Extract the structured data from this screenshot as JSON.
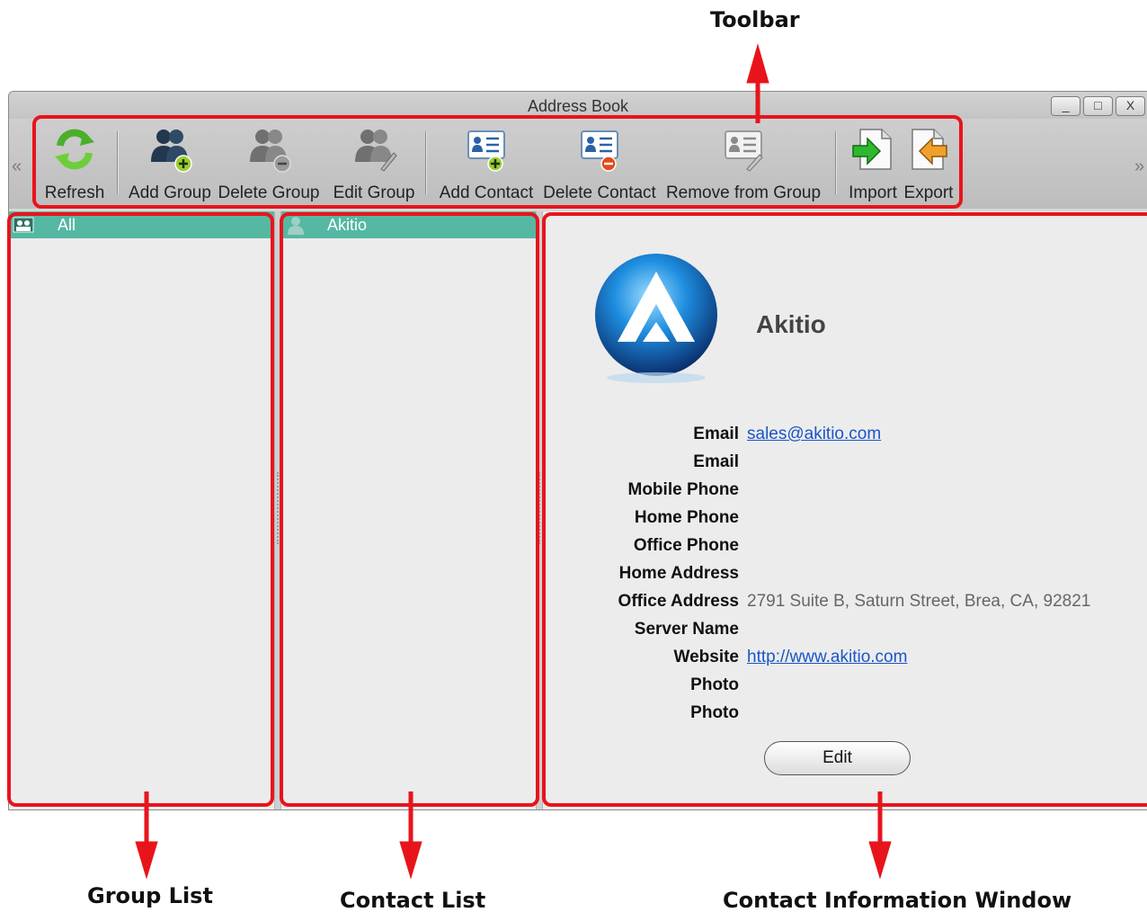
{
  "annotations": {
    "toolbar": "Toolbar",
    "group_list": "Group List",
    "contact_list": "Contact List",
    "contact_info": "Contact Information Window",
    "highlight_color": "#e8141c"
  },
  "window": {
    "title": "Address Book",
    "controls": {
      "minimize": "_",
      "maximize": "□",
      "close": "X"
    }
  },
  "toolbar": {
    "scroll_left": "«",
    "scroll_right": "»",
    "buttons": [
      {
        "label": "Refresh",
        "icon": "refresh-icon"
      },
      {
        "label": "Add Group",
        "icon": "add-group-icon"
      },
      {
        "label": "Delete Group",
        "icon": "delete-group-icon"
      },
      {
        "label": "Edit Group",
        "icon": "edit-group-icon"
      },
      {
        "label": "Add Contact",
        "icon": "add-contact-icon"
      },
      {
        "label": "Delete Contact",
        "icon": "delete-contact-icon"
      },
      {
        "label": "Remove from Group",
        "icon": "remove-from-group-icon"
      },
      {
        "label": "Import",
        "icon": "import-icon"
      },
      {
        "label": "Export",
        "icon": "export-icon"
      }
    ]
  },
  "groups": [
    {
      "label": "All",
      "selected": true
    }
  ],
  "contacts": [
    {
      "label": "Akitio",
      "selected": true
    }
  ],
  "contact": {
    "name": "Akitio",
    "avatar": "akitio-logo",
    "fields": [
      {
        "label": "Email",
        "value": "sales@akitio.com",
        "link": true
      },
      {
        "label": "Email",
        "value": ""
      },
      {
        "label": "Mobile Phone",
        "value": ""
      },
      {
        "label": "Home Phone",
        "value": ""
      },
      {
        "label": "Office Phone",
        "value": ""
      },
      {
        "label": "Home Address",
        "value": ""
      },
      {
        "label": "Office Address",
        "value": "2791 Suite B, Saturn Street, Brea, CA, 92821"
      },
      {
        "label": "Server Name",
        "value": ""
      },
      {
        "label": "Website",
        "value": "http://www.akitio.com",
        "link": true
      },
      {
        "label": "Photo",
        "value": ""
      },
      {
        "label": "Photo",
        "value": ""
      }
    ],
    "edit_label": "Edit"
  },
  "colors": {
    "selection": "#55b8a3",
    "link": "#1a55c9"
  }
}
